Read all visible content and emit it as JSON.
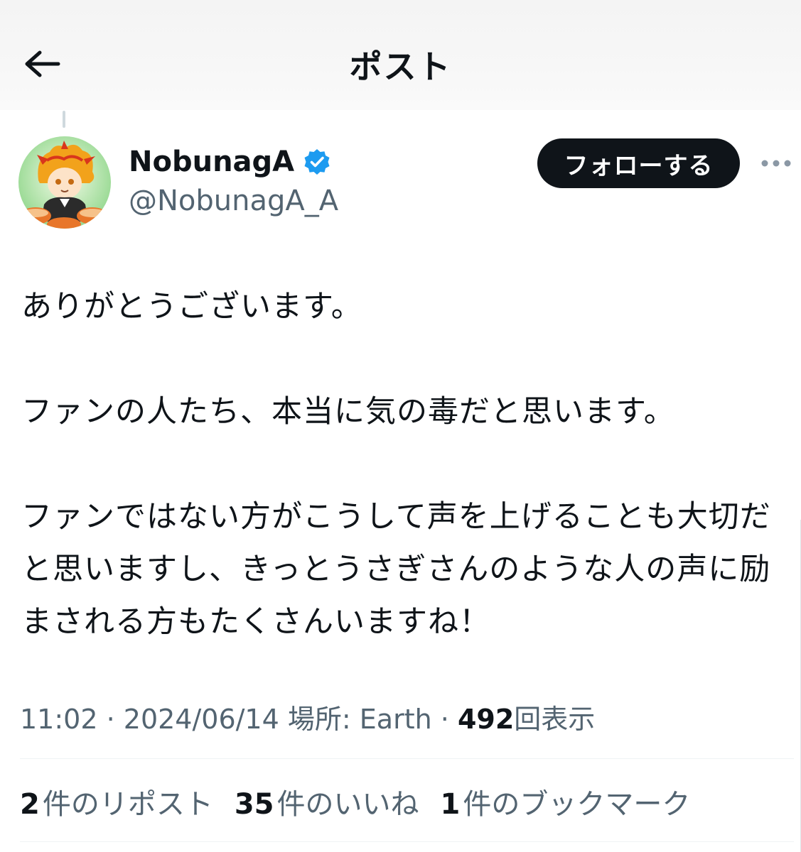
{
  "header": {
    "title": "ポスト",
    "back_icon": "arrow-left-icon"
  },
  "author": {
    "display_name": "NobunagA",
    "handle": "@NobunagA_A",
    "verified": true,
    "verified_color": "#1d9bf0",
    "avatar_icon": "avatar-illustration"
  },
  "follow_button": {
    "label": "フォローする"
  },
  "more_icon": "more-dots-icon",
  "tweet": {
    "paragraphs": [
      "ありがとうございます。",
      "ファンの人たち、本当に気の毒だと思います。",
      "ファンではない方がこうして声を上げることも大切だと思いますし、きっとうさぎさんのような人の声に励まされる方もたくさんいますね！"
    ]
  },
  "meta": {
    "time": "11:02",
    "date": "2024/06/14",
    "location": "場所: Earth",
    "separator": " · ",
    "views_count": "492",
    "views_label": "回表示"
  },
  "stats": {
    "reposts_count": "2",
    "reposts_label": "件のリポスト",
    "likes_count": "35",
    "likes_label": "件のいいね",
    "bookmarks_count": "1",
    "bookmarks_label": "件のブックマーク"
  },
  "colors": {
    "text_primary": "#0f1419",
    "text_secondary": "#536471",
    "button_bg": "#0f1419",
    "divider": "#eff3f4"
  }
}
